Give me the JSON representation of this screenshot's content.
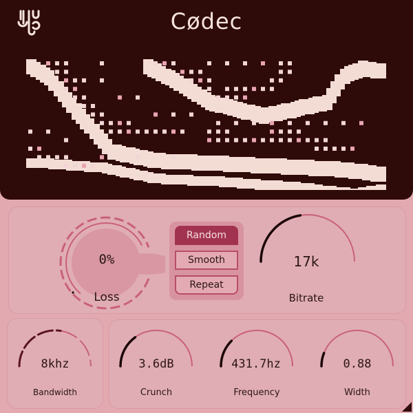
{
  "header": {
    "title": "Cødec",
    "logo_icon": "codec-logo-icon"
  },
  "colors": {
    "background": "#e3a9b1",
    "display_bg": "#2e0a09",
    "display_fg": "#f3dcd4",
    "accent": "#a23350",
    "arc_track": "#c9607a",
    "arc_value": "#1b0606"
  },
  "loss": {
    "label": "Loss",
    "value": "0%"
  },
  "modes": {
    "options": [
      "Random",
      "Smooth",
      "Repeat"
    ],
    "selected": "Random"
  },
  "bitrate": {
    "label": "Bitrate",
    "value": "17k",
    "fraction": 0.45
  },
  "bandwidth": {
    "label": "Bandwidth",
    "value": "8khz",
    "fraction": 0.55
  },
  "crunch": {
    "label": "Crunch",
    "value": "3.6dB",
    "fraction": 0.3
  },
  "frequency": {
    "label": "Frequency",
    "value": "431.7hz",
    "fraction": 0.25
  },
  "width": {
    "label": "Width",
    "value": "0.88",
    "fraction": 0.12
  }
}
